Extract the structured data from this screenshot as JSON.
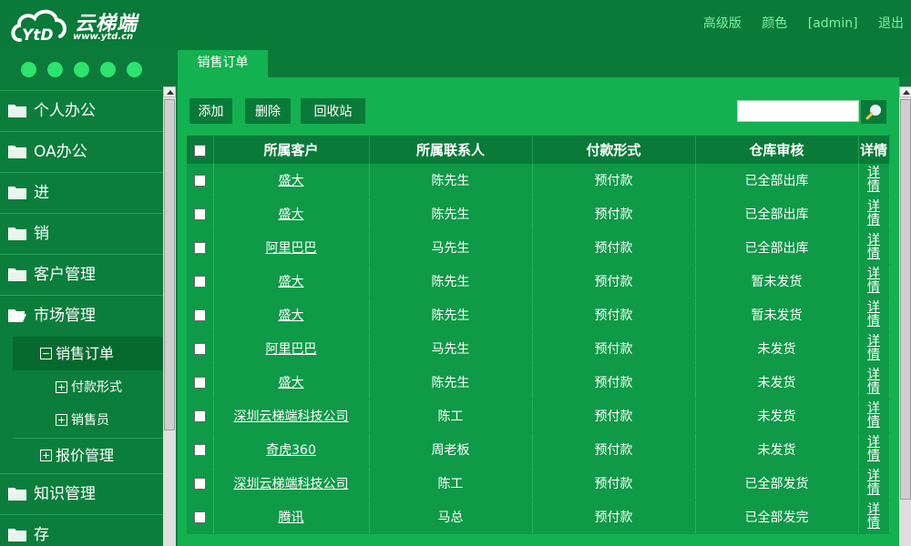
{
  "brand": {
    "name": "云梯端",
    "url": "www.ytd.cn"
  },
  "header": {
    "links": [
      "高级版",
      "颜色",
      "[admin]",
      "退出"
    ]
  },
  "tabs": [
    {
      "label": "销售订单"
    }
  ],
  "sidebar": {
    "items": [
      {
        "label": "个人办公"
      },
      {
        "label": "OA办公"
      },
      {
        "label": "进"
      },
      {
        "label": "销"
      },
      {
        "label": "客户管理"
      },
      {
        "label": "市场管理"
      }
    ],
    "market": {
      "active": "销售订单",
      "children": [
        "付款形式",
        "销售员"
      ],
      "quote": "报价管理"
    },
    "after": [
      {
        "label": "知识管理"
      },
      {
        "label": "存"
      }
    ]
  },
  "toolbar": {
    "add": "添加",
    "delete": "删除",
    "recycle": "回收站",
    "search_value": ""
  },
  "table": {
    "headers": {
      "customer": "所属客户",
      "contact": "所属联系人",
      "payment": "付款形式",
      "warehouse": "仓库审核",
      "detail": "详情"
    },
    "rows": [
      {
        "customer": "盛大",
        "contact": "陈先生",
        "payment": "预付款",
        "warehouse": "已全部出库",
        "detail": "详情"
      },
      {
        "customer": "盛大",
        "contact": "陈先生",
        "payment": "预付款",
        "warehouse": "已全部出库",
        "detail": "详情"
      },
      {
        "customer": "阿里巴巴",
        "contact": "马先生",
        "payment": "预付款",
        "warehouse": "已全部出库",
        "detail": "详情"
      },
      {
        "customer": "盛大",
        "contact": "陈先生",
        "payment": "预付款",
        "warehouse": "暂未发货",
        "detail": "详情"
      },
      {
        "customer": "盛大",
        "contact": "陈先生",
        "payment": "预付款",
        "warehouse": "暂未发货",
        "detail": "详情"
      },
      {
        "customer": "阿里巴巴",
        "contact": "马先生",
        "payment": "预付款",
        "warehouse": "未发货",
        "detail": "详情"
      },
      {
        "customer": "盛大",
        "contact": "陈先生",
        "payment": "预付款",
        "warehouse": "未发货",
        "detail": "详情"
      },
      {
        "customer": "深圳云梯端科技公司",
        "contact": "陈工",
        "payment": "预付款",
        "warehouse": "未发货",
        "detail": "详情"
      },
      {
        "customer": "奇虎360",
        "contact": "周老板",
        "payment": "预付款",
        "warehouse": "未发货",
        "detail": "详情"
      },
      {
        "customer": "深圳云梯端科技公司",
        "contact": "陈工",
        "payment": "预付款",
        "warehouse": "已全部发货",
        "detail": "详情"
      },
      {
        "customer": "腾讯",
        "contact": "马总",
        "payment": "预付款",
        "warehouse": "已全部发完",
        "detail": "详情"
      }
    ]
  },
  "colors": {
    "dark": "#0a7a39",
    "main": "#14b150",
    "row": "#0e9a47",
    "link": "#7ff0a2",
    "dot": "#2ee36d"
  },
  "icons": [
    "logo-cloud-icon",
    "folder-icon",
    "folder-open-icon",
    "collapse-box-icon",
    "expand-box-icon",
    "search-icon",
    "checkbox-icon"
  ]
}
